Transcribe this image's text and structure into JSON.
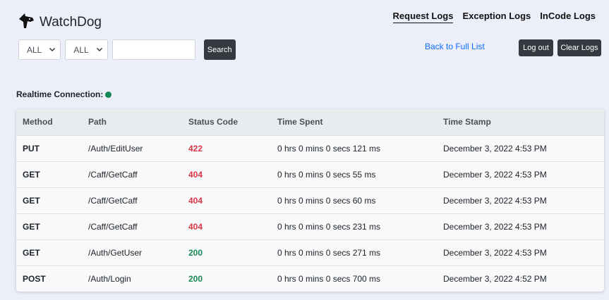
{
  "header": {
    "brand": "WatchDog",
    "nav": [
      {
        "label": "Request Logs",
        "active": true
      },
      {
        "label": "Exception Logs",
        "active": false
      },
      {
        "label": "InCode Logs",
        "active": false
      }
    ]
  },
  "filters": {
    "method_select": "ALL",
    "status_select": "ALL",
    "search_value": "",
    "search_label": "Search"
  },
  "actions": {
    "back_label": "Back to Full List",
    "logout_label": "Log out",
    "clear_label": "Clear Logs"
  },
  "realtime": {
    "label": "Realtime Connection:",
    "status_color": "#198754"
  },
  "table": {
    "columns": [
      "Method",
      "Path",
      "Status Code",
      "Time Spent",
      "Time Stamp"
    ],
    "rows": [
      {
        "method": "PUT",
        "path": "/Auth/EditUser",
        "status": "422",
        "time_spent": "0 hrs 0 mins 0 secs 121 ms",
        "timestamp": "December 3, 2022 4:53 PM"
      },
      {
        "method": "GET",
        "path": "/Caff/GetCaff",
        "status": "404",
        "time_spent": "0 hrs 0 mins 0 secs 55 ms",
        "timestamp": "December 3, 2022 4:53 PM"
      },
      {
        "method": "GET",
        "path": "/Caff/GetCaff",
        "status": "404",
        "time_spent": "0 hrs 0 mins 0 secs 60 ms",
        "timestamp": "December 3, 2022 4:53 PM"
      },
      {
        "method": "GET",
        "path": "/Caff/GetCaff",
        "status": "404",
        "time_spent": "0 hrs 0 mins 0 secs 231 ms",
        "timestamp": "December 3, 2022 4:53 PM"
      },
      {
        "method": "GET",
        "path": "/Auth/GetUser",
        "status": "200",
        "time_spent": "0 hrs 0 mins 0 secs 271 ms",
        "timestamp": "December 3, 2022 4:53 PM"
      },
      {
        "method": "POST",
        "path": "/Auth/Login",
        "status": "200",
        "time_spent": "0 hrs 0 mins 0 secs 700 ms",
        "timestamp": "December 3, 2022 4:52 PM"
      }
    ]
  },
  "colors": {
    "error_status": "#dc3545",
    "ok_status": "#198754",
    "link": "#0d6efd",
    "button_dark": "#343a40"
  },
  "icons": {
    "brand": "dog-head-icon",
    "select_caret": "chevron-down-icon"
  }
}
